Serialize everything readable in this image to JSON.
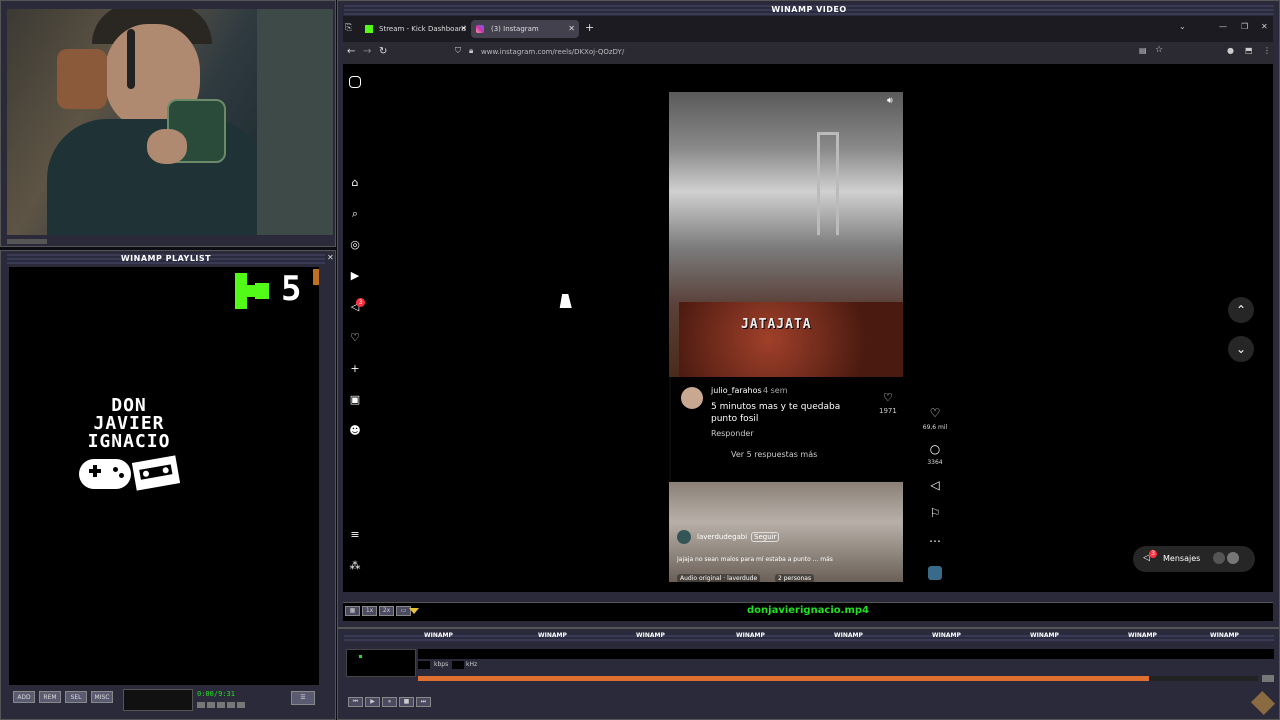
{
  "webcam": {
    "caption": "webcam feed"
  },
  "playlist": {
    "title": "WINAMP PLAYLIST",
    "kick_count": "5",
    "logo_lines": [
      "DON",
      "JAVIER",
      "IGNACIO"
    ],
    "buttons": [
      "ADD",
      "REM",
      "SEL",
      "MISC"
    ],
    "time": "0:00/9:31"
  },
  "video_window": {
    "title": "WINAMP VIDEO",
    "filename": "donjavierignacio.mp4"
  },
  "browser": {
    "tabs": [
      {
        "label": "Stream - Kick Dashboard",
        "active": false
      },
      {
        "label": "(3) Instagram",
        "active": true
      }
    ],
    "url": "www.instagram.com/reels/DKXoj-QOzDY/"
  },
  "instagram": {
    "notifications_badge": "3",
    "reel_overlay_text": "JATAJATA",
    "comment": {
      "user": "julio_farahos",
      "age": "4 sem",
      "text": "5 minutos mas y te quedaba punto fosil",
      "likes": "1971",
      "reply_label": "Responder",
      "more_replies": "Ver 5 respuestas más"
    },
    "author": {
      "name": "laverdudegabi",
      "follow": "Seguir"
    },
    "caption": "Jajaja no sean malos para mí estaba a punto ... más",
    "audio": "Audio original · laverdude",
    "people": "2 personas",
    "likes": "69,6 mil",
    "comments": "3364",
    "messages_label": "Mensajes",
    "messages_badge": "3"
  },
  "winamp_main": {
    "label_repeat": "WINAMP",
    "kbps_label": "kbps",
    "khz_label": "kHz",
    "progress": 0.87
  },
  "colors": {
    "accent_green": "#53fc18",
    "filename_green": "#22e022",
    "frame": "#2a2a3a",
    "progress_orange": "#e07030"
  }
}
